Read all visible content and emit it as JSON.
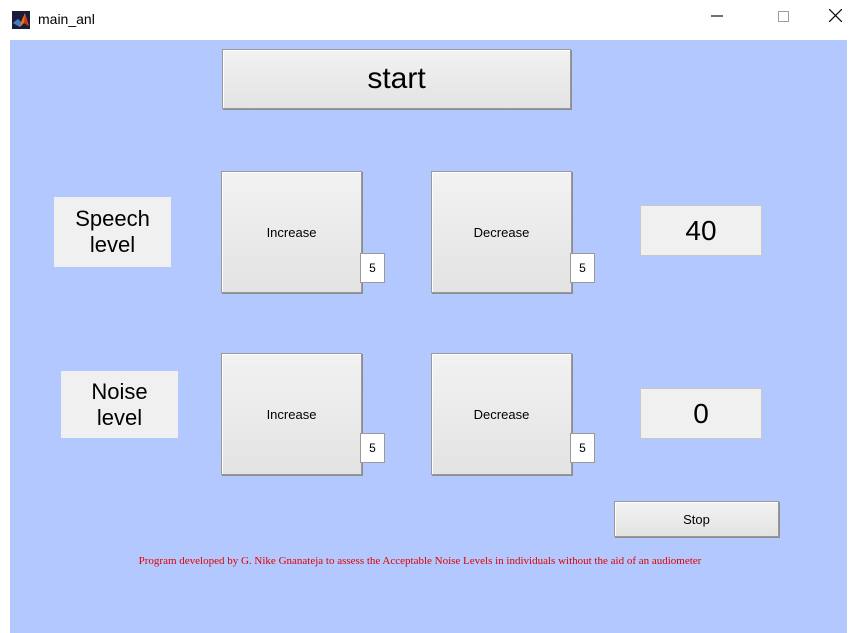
{
  "window": {
    "title": "main_anl"
  },
  "controls": {
    "start_label": "start",
    "stop_label": "Stop"
  },
  "speech": {
    "label_line1": "Speech",
    "label_line2": "level",
    "increase_label": "Increase",
    "increase_step": "5",
    "decrease_label": "Decrease",
    "decrease_step": "5",
    "value": "40"
  },
  "noise": {
    "label_line1": "Noise",
    "label_line2": "level",
    "increase_label": "Increase",
    "increase_step": "5",
    "decrease_label": "Decrease",
    "decrease_step": "5",
    "value": "0"
  },
  "footer": {
    "text": "Program developed by G. Nike Gnanateja to assess the Acceptable Noise Levels in individuals without the aid of an audiometer"
  },
  "icons": {
    "app": "matlab-icon",
    "minimize": "minimize-icon",
    "maximize": "maximize-icon",
    "close": "close-icon"
  },
  "colors": {
    "background": "#b3c8ff",
    "footer_text": "#e00000"
  }
}
